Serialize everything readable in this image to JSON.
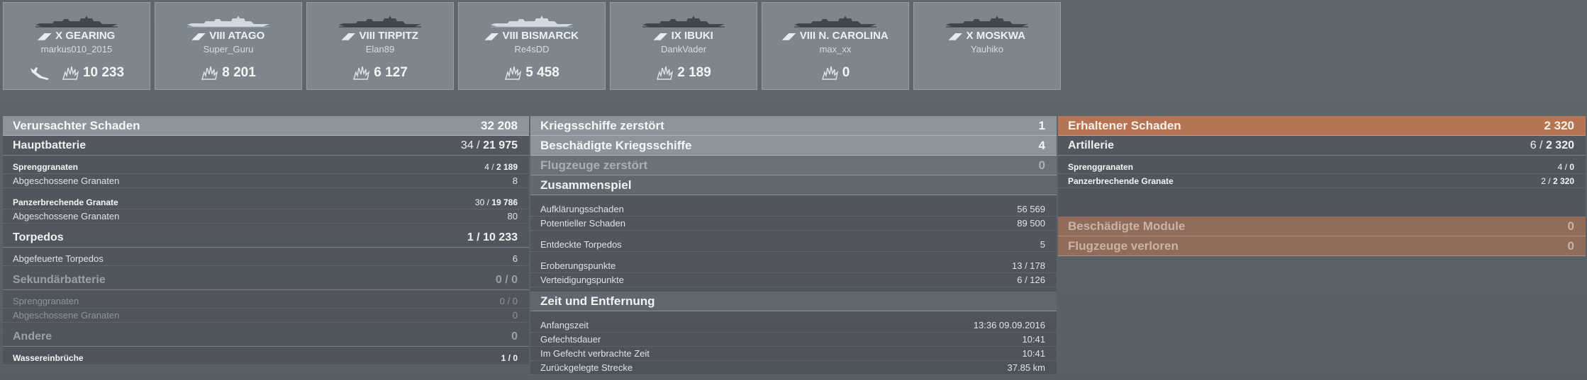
{
  "ships": [
    {
      "cls": "X",
      "name": "GEARING",
      "player": "markus010_2015",
      "damage": "10 233",
      "has_plane": true,
      "light": false
    },
    {
      "cls": "VIII",
      "name": "ATAGO",
      "player": "Super_Guru",
      "damage": "8 201",
      "has_plane": false,
      "light": true
    },
    {
      "cls": "VIII",
      "name": "TIRPITZ",
      "player": "Elan89",
      "damage": "6 127",
      "has_plane": false,
      "light": false
    },
    {
      "cls": "VIII",
      "name": "BISMARCK",
      "player": "Re4sDD",
      "damage": "5 458",
      "has_plane": false,
      "light": true
    },
    {
      "cls": "IX",
      "name": "IBUKI",
      "player": "DankVader",
      "damage": "2 189",
      "has_plane": false,
      "light": false
    },
    {
      "cls": "VIII",
      "name": "N. CAROLINA",
      "player": "max_xx",
      "damage": "0",
      "has_plane": false,
      "light": false
    },
    {
      "cls": "X",
      "name": "MOSKWA",
      "player": "Yauhiko",
      "damage": "",
      "has_plane": false,
      "light": false
    }
  ],
  "left": {
    "title": "Verursachter Schaden",
    "total": "32 208",
    "main_battery": {
      "label": "Hauptbatterie",
      "hits": "34",
      "dmg": "21 975"
    },
    "he_label": "Sprenggranaten",
    "he_hits": "4",
    "he_dmg": "2 189",
    "he_fired_label": "Abgeschossene Granaten",
    "he_fired": "8",
    "ap_label": "Panzerbrechende Granate",
    "ap_hits": "30",
    "ap_dmg": "19 786",
    "ap_fired_label": "Abgeschossene Granaten",
    "ap_fired": "80",
    "torp": {
      "label": "Torpedos",
      "hits": "1",
      "dmg": "10 233"
    },
    "torp_fired_label": "Abgefeuerte Torpedos",
    "torp_fired": "6",
    "secondary": {
      "label": "Sekundärbatterie",
      "value": "0 / 0"
    },
    "sec_he_label": "Sprenggranaten",
    "sec_he": "0 / 0",
    "sec_fired_label": "Abgeschossene Granaten",
    "sec_fired": "0",
    "other": {
      "label": "Andere",
      "value": "0"
    },
    "flood_label": "Wassereinbrüche",
    "flood_hits": "1",
    "flood_dmg": "0"
  },
  "middle": {
    "destroyed": {
      "label": "Kriegsschiffe zerstört",
      "value": "1"
    },
    "damaged": {
      "label": "Beschädigte Kriegsschiffe",
      "value": "4"
    },
    "planes": {
      "label": "Flugzeuge zerstört",
      "value": "0"
    },
    "team": {
      "title": "Zusammenspiel",
      "rows": [
        {
          "label": "Aufklärungsschaden",
          "value": "56 569"
        },
        {
          "label": "Potentieller Schaden",
          "value": "89 500"
        },
        {
          "label": "Entdeckte Torpedos",
          "value": "5"
        },
        {
          "label": "Eroberungspunkte",
          "value": "13 / 178"
        },
        {
          "label": "Verteidigungspunkte",
          "value": "6 / 126"
        }
      ]
    },
    "time": {
      "title": "Zeit und Entfernung",
      "rows": [
        {
          "label": "Anfangszeit",
          "value": "13:36  09.09.2016"
        },
        {
          "label": "Gefechtsdauer",
          "value": "10:41"
        },
        {
          "label": "Im Gefecht verbrachte Zeit",
          "value": "10:41"
        },
        {
          "label": "Zurückgelegte Strecke",
          "value": "37.85 km"
        }
      ]
    }
  },
  "right": {
    "title": "Erhaltener Schaden",
    "total": "2 320",
    "artillery": {
      "label": "Artillerie",
      "hits": "6",
      "dmg": "2 320"
    },
    "he_label": "Sprenggranaten",
    "he_hits": "4",
    "he_dmg": "0",
    "ap_label": "Panzerbrechende Granate",
    "ap_hits": "2",
    "ap_dmg": "2 320",
    "modules": {
      "label": "Beschädigte Module",
      "value": "0"
    },
    "planes_lost": {
      "label": "Flugzeuge verloren",
      "value": "0"
    }
  },
  "colors": {
    "accent_orange": "#c47850",
    "panel_light": "#b4bec3",
    "bg": "#5b6369"
  },
  "icons": {
    "ship": "ship-silhouette-icon",
    "class": "ship-class-icon",
    "damage": "damage-burst-icon",
    "plane": "aircraft-icon"
  }
}
